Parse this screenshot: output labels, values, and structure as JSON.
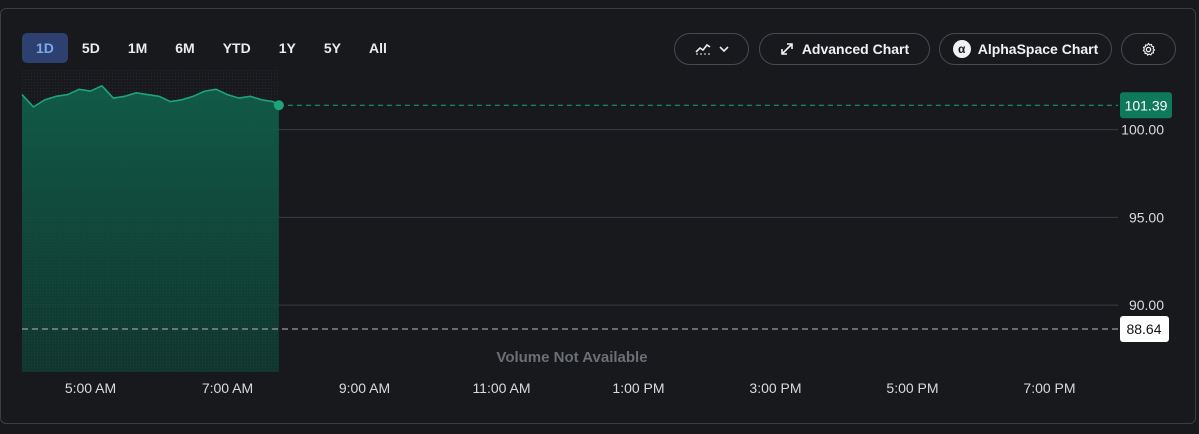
{
  "ranges": [
    "1D",
    "5D",
    "1M",
    "6M",
    "YTD",
    "1Y",
    "5Y",
    "All"
  ],
  "active_range": "1D",
  "toolbar": {
    "chart_type_icon": "line-chart-icon",
    "dropdown_icon": "chevron-down-icon",
    "advanced_icon": "expand-arrows-icon",
    "advanced_label": "Advanced Chart",
    "alpha_icon": "alpha-icon",
    "alpha_symbol": "α",
    "alpha_label": "AlphaSpace Chart",
    "settings_icon": "gear-icon"
  },
  "colors": {
    "line": "#1fa37a",
    "area_top": "#0f5f4a",
    "price_tag_bg": "#0e7a5b",
    "grid": "#3a3d44",
    "axis_text": "#d8dadd",
    "prev_close_line": "#9a9ca1"
  },
  "chart_data": {
    "type": "area",
    "x": [
      "4:00 AM",
      "4:10 AM",
      "4:20 AM",
      "4:30 AM",
      "4:40 AM",
      "4:50 AM",
      "5:00 AM",
      "5:10 AM",
      "5:20 AM",
      "5:30 AM",
      "5:40 AM",
      "5:50 AM",
      "6:00 AM",
      "6:10 AM",
      "6:20 AM",
      "6:30 AM",
      "6:40 AM",
      "6:50 AM",
      "7:00 AM",
      "7:10 AM",
      "7:20 AM",
      "7:30 AM",
      "7:40 AM",
      "7:45 AM"
    ],
    "x_minutes": [
      0,
      10,
      20,
      30,
      40,
      50,
      60,
      70,
      80,
      90,
      100,
      110,
      120,
      130,
      140,
      150,
      160,
      170,
      180,
      190,
      200,
      210,
      220,
      225
    ],
    "values": [
      102.0,
      101.3,
      101.7,
      101.9,
      102.0,
      102.3,
      102.2,
      102.5,
      101.8,
      101.9,
      102.1,
      102.0,
      101.9,
      101.6,
      101.7,
      101.9,
      102.2,
      102.3,
      102.0,
      101.8,
      101.9,
      101.7,
      101.6,
      101.39
    ],
    "xlim_minutes": [
      0,
      960
    ],
    "xticks": [
      "5:00 AM",
      "7:00 AM",
      "9:00 AM",
      "11:00 AM",
      "1:00 PM",
      "3:00 PM",
      "5:00 PM",
      "7:00 PM"
    ],
    "xtick_minutes": [
      60,
      180,
      300,
      420,
      540,
      660,
      780,
      900
    ],
    "yticks": [
      "100.00",
      "95.00",
      "90.00"
    ],
    "ytick_values": [
      100,
      95,
      90
    ],
    "ylim": [
      87.9,
      103.4
    ],
    "last_price": "101.39",
    "last_price_value": 101.39,
    "previous_close": "88.64",
    "previous_close_value": 88.64,
    "volume_message": "Volume Not Available",
    "grid": true
  }
}
